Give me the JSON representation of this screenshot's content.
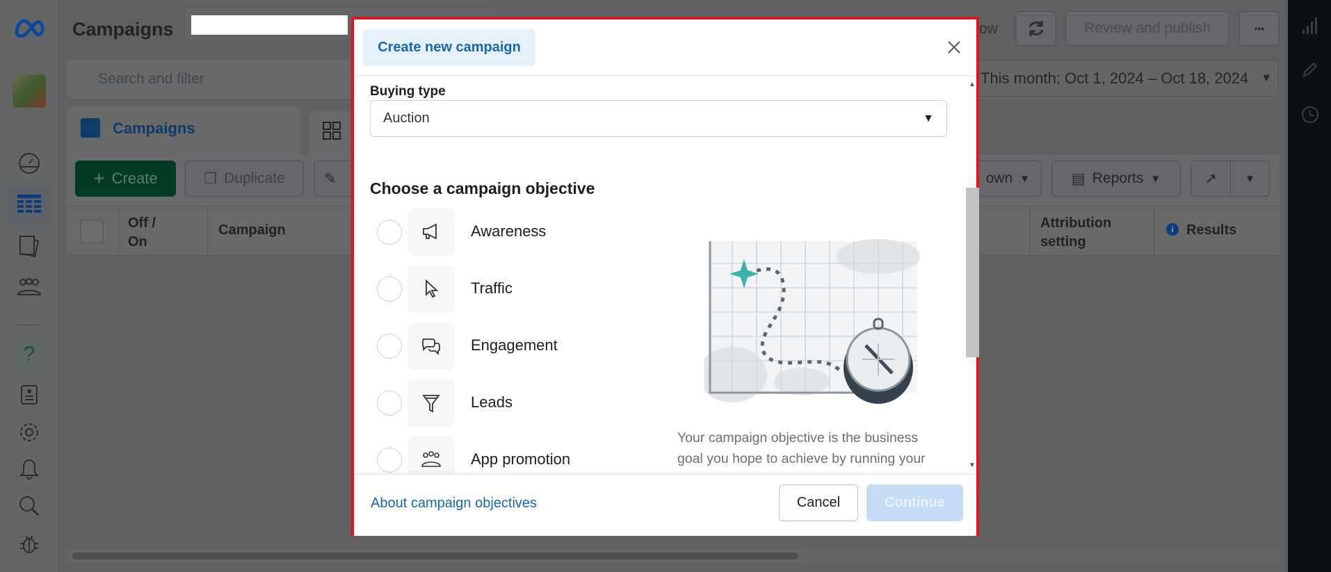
{
  "header": {
    "title": "Campaigns",
    "search_placeholder": "Search and filter",
    "partial_button": "ow",
    "review_publish": "Review and publish",
    "more": "•••",
    "date_range": "This month: Oct 1, 2024 – Oct 18, 2024"
  },
  "tabs": [
    {
      "label": "Campaigns",
      "active": true
    }
  ],
  "toolbar": {
    "create": "Create",
    "duplicate": "Duplicate",
    "breakdown_partial": "own",
    "reports": "Reports"
  },
  "table": {
    "columns": [
      "Off / On",
      "Campaign",
      "Attribution setting",
      "Results"
    ]
  },
  "sidebar": {
    "icons": [
      "meta-logo",
      "account-avatar",
      "dashboard-icon",
      "campaigns-table-icon",
      "pages-icon",
      "audiences-icon",
      "help-icon",
      "news-icon",
      "settings-icon",
      "notifications-icon",
      "search-icon",
      "bug-icon"
    ]
  },
  "right_sidebar": {
    "icons": [
      "chart-icon",
      "pencil-icon",
      "clock-icon"
    ]
  },
  "modal": {
    "title": "Create new campaign",
    "buying_type_label": "Buying type",
    "buying_type_value": "Auction",
    "objective_heading": "Choose a campaign objective",
    "objectives": [
      {
        "label": "Awareness",
        "icon": "megaphone-icon"
      },
      {
        "label": "Traffic",
        "icon": "cursor-icon"
      },
      {
        "label": "Engagement",
        "icon": "chat-bubbles-icon"
      },
      {
        "label": "Leads",
        "icon": "funnel-icon"
      },
      {
        "label": "App promotion",
        "icon": "people-icon"
      }
    ],
    "description": "Your campaign objective is the business goal you hope to achieve by running your ads. Hover over each one for more",
    "about_link": "About campaign objectives",
    "cancel": "Cancel",
    "continue": "Continue"
  },
  "colors": {
    "modal_border": "#e3141d",
    "link": "#1467b0",
    "continue_disabled": "#c4dcf5",
    "create_green": "#033a24",
    "accent_teal": "#3bb3ac"
  }
}
